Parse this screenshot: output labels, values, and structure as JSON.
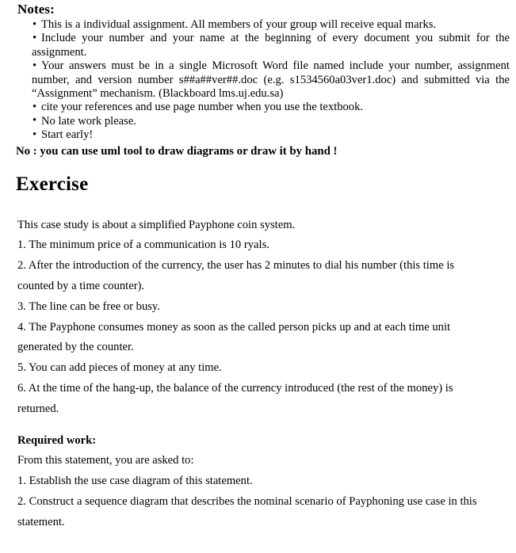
{
  "document": {
    "notes": {
      "heading": "Notes:",
      "bullet_glyph": "•",
      "items": [
        "This is a individual assignment. All members of your group will receive equal marks.",
        "Include your number and your name at the beginning of every document you submit for the assignment.",
        "Your answers must be in a single Microsoft Word file named include your number, assignment number, and version number s##a##ver##.doc (e.g. s1534560a03ver1.doc) and submitted via the “Assignment” mechanism. (Blackboard  lms.uj.edu.sa)",
        "cite your references and use page number when you use the textbook.",
        "No late work please.",
        "Start early!"
      ],
      "no_line": "No : you can use uml tool to draw diagrams or  draw it by hand !"
    },
    "exercise": {
      "heading": "Exercise",
      "intro": "This case study is about a simplified Payphone coin system.",
      "statements": [
        "1. The minimum price of a communication is 10 ryals.",
        "2. After the introduction of the currency, the user has 2 minutes to dial his number (this time is counted by a time counter).",
        "3. The line can be free or busy.",
        "4. The Payphone consumes money as soon as the called person picks up and at each time unit generated by the counter.",
        "5. You can add pieces of money at any time.",
        "6. At the time of the hang-up, the balance of the currency introduced (the rest of the money)  is returned."
      ]
    },
    "required_work": {
      "heading": "Required work:",
      "intro": "From this statement, you are asked to:",
      "tasks": [
        "1. Establish the use case diagram of this statement.",
        "2. Construct a sequence diagram that describes the nominal scenario of Payphoning use case in this statement."
      ]
    }
  }
}
